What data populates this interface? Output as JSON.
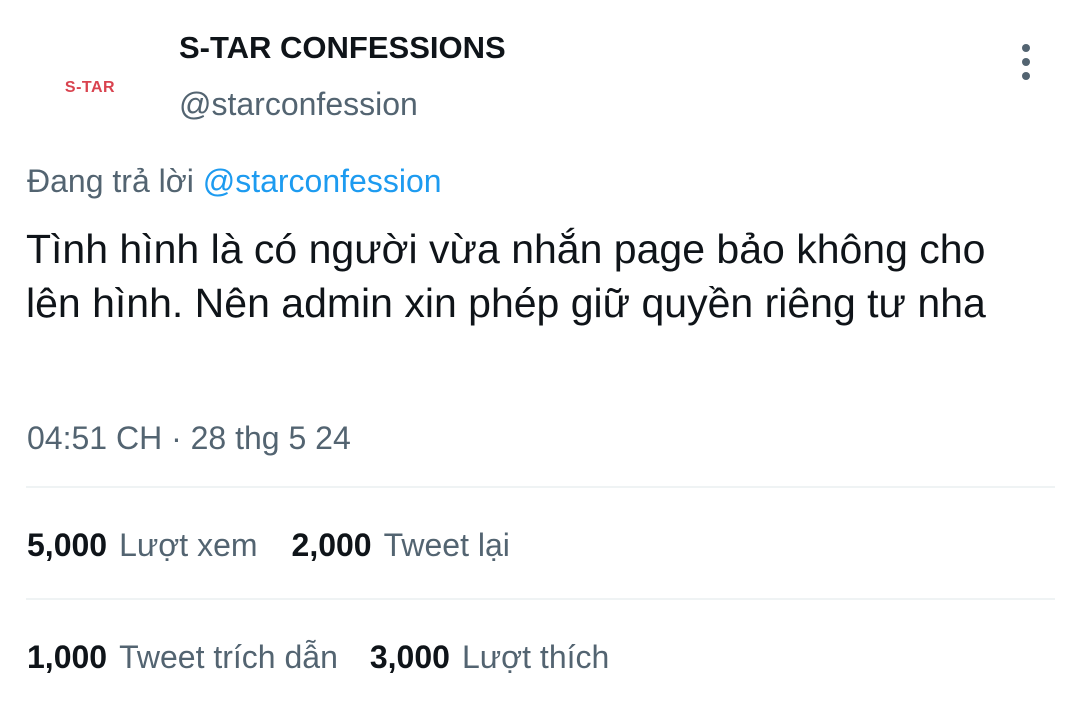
{
  "author": {
    "avatar_text": "S-TAR",
    "display_name": "S-TAR CONFESSIONS",
    "handle": "@starconfession"
  },
  "reply": {
    "prefix": "Đang trả lời",
    "mention": "@starconfession"
  },
  "tweet": {
    "text": "Tình hình là có người vừa nhắn page bảo không cho lên hình. Nên admin xin phép giữ quyền riêng tư nha",
    "timestamp": "04:51 CH · 28 thg 5 24"
  },
  "stats": {
    "views": {
      "value": "5,000",
      "label": "Lượt xem"
    },
    "retweets": {
      "value": "2,000",
      "label": "Tweet lại"
    },
    "quotes": {
      "value": "1,000",
      "label": "Tweet trích dẫn"
    },
    "likes": {
      "value": "3,000",
      "label": "Lượt thích"
    }
  },
  "icons": {
    "more": "more-vertical-icon"
  },
  "colors": {
    "text_primary": "#0f1419",
    "text_secondary": "#536471",
    "mention_blue": "#1d9bf0",
    "avatar_red": "#d9434f",
    "divider": "#eff3f4"
  }
}
